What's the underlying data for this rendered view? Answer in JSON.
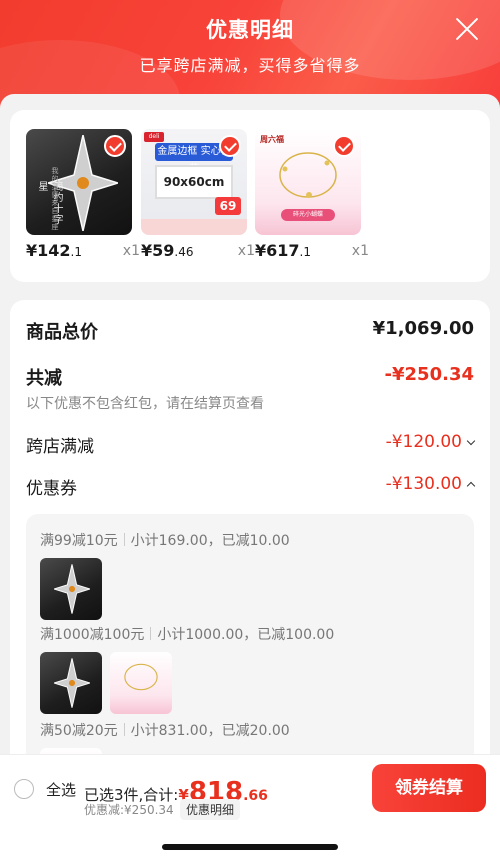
{
  "header": {
    "title": "优惠明细",
    "subtitle": "已享跨店满减，买得多省得多"
  },
  "products": [
    {
      "price_int": "¥142",
      "price_dec": ".1",
      "qty": "x1",
      "image": "star-pendant-necklace",
      "vertical_text": "简约十字星",
      "small_text": "我的灵感来自星座"
    },
    {
      "price_int": "¥59",
      "price_dec": ".46",
      "qty": "x1",
      "image": "metal-frame-board",
      "brand": "deli",
      "title_text": "金属边框 实心板芯",
      "size_text": "90x60cm",
      "badge": "69"
    },
    {
      "price_int": "¥617",
      "price_dec": ".1",
      "qty": "x1",
      "image": "gold-bracelet",
      "brand": "周六福",
      "banner": "碎光小蝴蝶"
    }
  ],
  "summary": {
    "total_label": "商品总价",
    "total_value": "¥1,069.00",
    "discount_label": "共减",
    "discount_value": "-¥250.34",
    "discount_hint": "以下优惠不包含红包，请在结算页查看",
    "cross_store_label": "跨店满减",
    "cross_store_value": "-¥120.00",
    "coupon_label": "优惠券",
    "coupon_value": "-¥130.00"
  },
  "coupons": [
    {
      "rule": "满99减10元",
      "detail": "小计169.00，已减10.00"
    },
    {
      "rule": "满1000减100元",
      "detail": "小计1000.00，已减100.00"
    },
    {
      "rule": "满50减20元",
      "detail": "小计831.00，已减20.00"
    }
  ],
  "footer": {
    "select_all": "全选",
    "selected_text": "已选3件,合计:",
    "currency": "¥",
    "amount_int": "818",
    "amount_dec": ".66",
    "discount_line": "优惠减:¥250.34",
    "detail_link": "优惠明细",
    "checkout_label": "领券结算"
  },
  "colors": {
    "accent": "#f23c2e",
    "price_red": "#e8301f"
  }
}
